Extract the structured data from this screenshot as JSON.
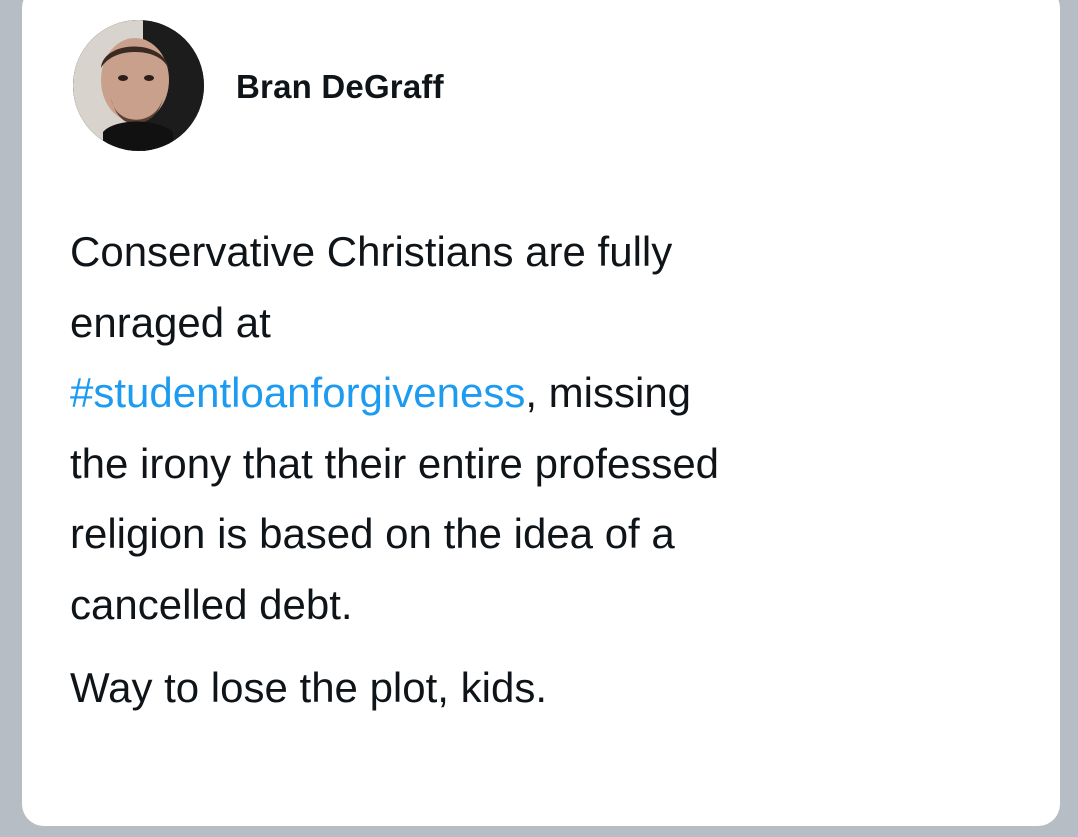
{
  "tweet": {
    "author_name": "Bran DeGraff",
    "avatar_icon": "profile-photo",
    "lines": [
      "Conservative Christians are fully",
      "enraged at",
      "#studentloanforgiveness",
      ", missing",
      "the irony that their entire professed",
      "religion is based on the idea of a",
      "cancelled debt."
    ],
    "hashtag": "#studentloanforgiveness",
    "closing": "Way to lose the plot, kids."
  },
  "colors": {
    "background": "#b7bdc4",
    "card": "#ffffff",
    "text": "#0f1419",
    "hashtag": "#1d9bf0"
  }
}
